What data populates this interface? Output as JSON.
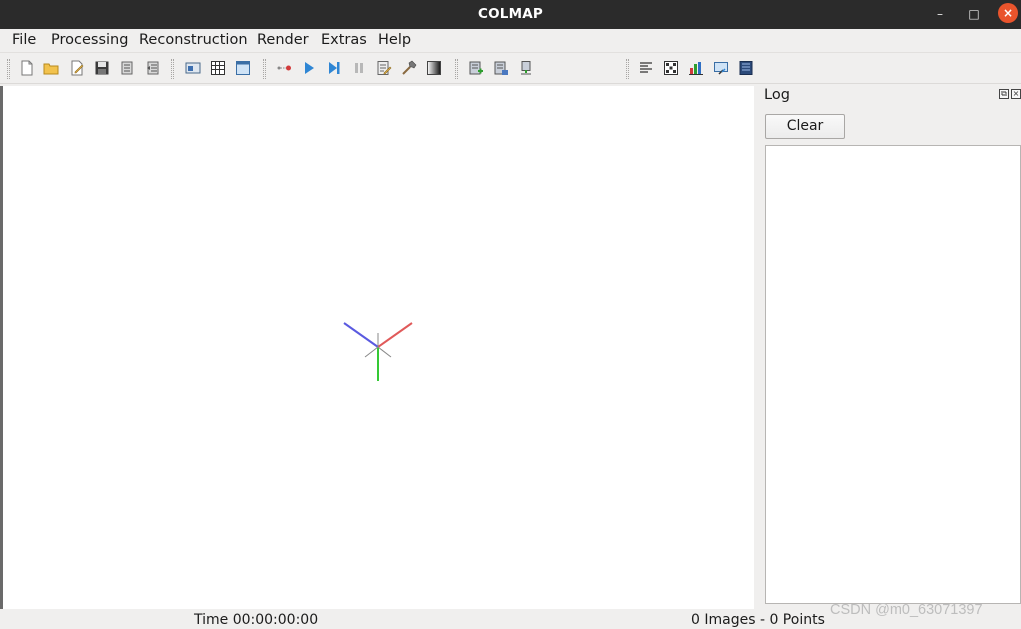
{
  "window": {
    "title": "COLMAP",
    "minimize_glyph": "–",
    "maximize_glyph": "□",
    "close_glyph": "×"
  },
  "menu": {
    "items": [
      "File",
      "Processing",
      "Reconstruction",
      "Render",
      "Extras",
      "Help"
    ]
  },
  "toolbar": {
    "icons": [
      "new-project-icon",
      "open-project-icon",
      "edit-project-icon",
      "save-project-icon",
      "import-model-icon",
      "export-model-icon",
      "feature-extraction-icon",
      "feature-matching-icon",
      "database-management-icon",
      "automatic-reconstruction-icon",
      "start-reconstruction-icon",
      "step-reconstruction-icon",
      "pause-reconstruction-icon",
      "reconstruction-options-icon",
      "bundle-adjustment-icon",
      "dense-reconstruction-icon",
      "render-options-icon",
      "reset-view-icon",
      "grab-movie-icon",
      "reconstruction-stats-icon",
      "match-matrix-icon",
      "show-log-icon",
      "grab-image-icon",
      "undistort-icon"
    ],
    "model_selector_value": ""
  },
  "log": {
    "title": "Log",
    "clear_label": "Clear",
    "float_glyph": "⧉",
    "close_glyph": "×",
    "content": ""
  },
  "status": {
    "time": "Time 00:00:00:00",
    "counts": "0 Images - 0 Points"
  },
  "watermark": "CSDN @m0_63071397",
  "colors": {
    "axis_x": "#e05a5a",
    "axis_y": "#35c935",
    "axis_z": "#5a5ae0",
    "titlebar": "#2b2b2b",
    "close_button": "#e9542c"
  }
}
